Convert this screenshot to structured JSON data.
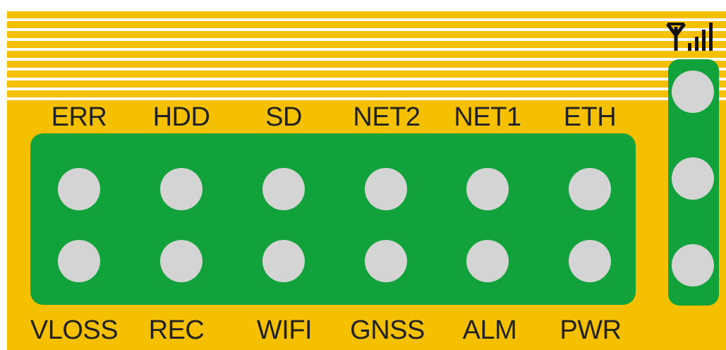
{
  "colors": {
    "panel": "#f5c000",
    "board": "#12a23c",
    "led": "#d4d4d4",
    "stripe": "#ffffff",
    "text": "#222222"
  },
  "top_row_labels": [
    "ERR",
    "HDD",
    "SD",
    "NET2",
    "NET1",
    "ETH"
  ],
  "bottom_row_labels": [
    "VLOSS",
    "REC",
    "WIFI",
    "GNSS",
    "ALM",
    "PWR"
  ],
  "side_column_leds": 3,
  "icons": {
    "antenna": "antenna-signal-icon"
  }
}
